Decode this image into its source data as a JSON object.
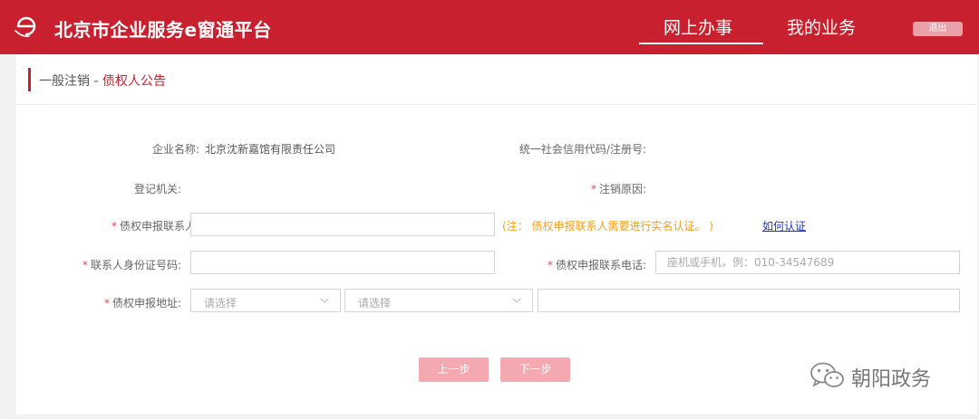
{
  "header": {
    "title": "北京市企业服务e窗通平台",
    "nav": {
      "online": "网上办事",
      "mine": "我的业务"
    },
    "logout": "退出",
    "logo_icon": "e-logo-icon",
    "colors": {
      "brand": "#c8202f"
    }
  },
  "page": {
    "breadcrumb_main": "一般注销 - ",
    "breadcrumb_sub": "债权人公告"
  },
  "form": {
    "required_mark": "*",
    "company_name_label": "企业名称:",
    "company_name_value": "北京沈新嘉馆有限责任公司",
    "credit_code_label": "统一社会信用代码/注册号:",
    "registry_label": "登记机关:",
    "cancel_reason_label": "注销原因:",
    "contact_label": "债权申报联系人:",
    "contact_note": "(注： 债权申报联系人需要进行实名认证。 )",
    "how_to_verify": "如何认证",
    "id_label": "联系人身份证号码:",
    "phone_label": "债权申报联系电话:",
    "phone_placeholder": "座机或手机，例：010-34547689",
    "address_label": "债权申报地址:",
    "select1": "请选择",
    "select2": "请选择"
  },
  "buttons": {
    "prev": "上一步",
    "next": "下一步"
  },
  "watermark": {
    "text": "朝阳政务",
    "icon": "wechat-icon"
  }
}
